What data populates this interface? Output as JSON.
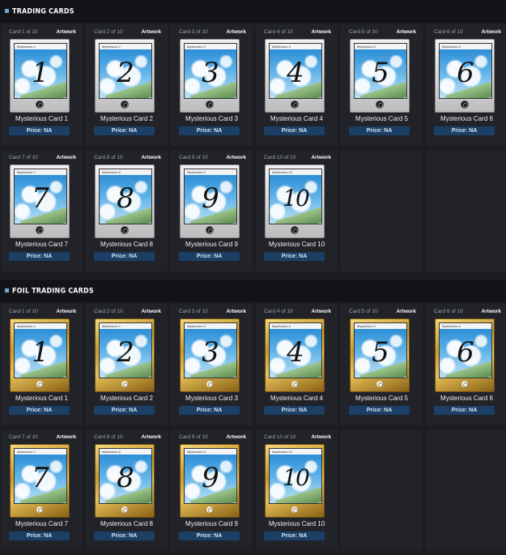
{
  "sections": [
    {
      "title": "TRADING CARDS",
      "variant": "normal",
      "cards": [
        {
          "counter": "Card 1 of 10",
          "artwork": "Artwork",
          "label": "Mysterious 1",
          "number": "1",
          "name": "Mysterious Card 1",
          "price": "Price: NA"
        },
        {
          "counter": "Card 2 of 10",
          "artwork": "Artwork",
          "label": "Mysterious 2",
          "number": "2",
          "name": "Mysterious Card 2",
          "price": "Price: NA"
        },
        {
          "counter": "Card 3 of 10",
          "artwork": "Artwork",
          "label": "Mysterious 3",
          "number": "3",
          "name": "Mysterious Card 3",
          "price": "Price: NA"
        },
        {
          "counter": "Card 4 of 10",
          "artwork": "Artwork",
          "label": "Mysterious 4",
          "number": "4",
          "name": "Mysterious Card 4",
          "price": "Price: NA"
        },
        {
          "counter": "Card 5 of 10",
          "artwork": "Artwork",
          "label": "Mysterious 5",
          "number": "5",
          "name": "Mysterious Card 5",
          "price": "Price: NA"
        },
        {
          "counter": "Card 6 of 10",
          "artwork": "Artwork",
          "label": "Mysterious 6",
          "number": "6",
          "name": "Mysterious Card 6",
          "price": "Price: NA"
        },
        {
          "counter": "Card 7 of 10",
          "artwork": "Artwork",
          "label": "Mysterious 7",
          "number": "7",
          "name": "Mysterious Card 7",
          "price": "Price: NA"
        },
        {
          "counter": "Card 8 of 10",
          "artwork": "Artwork",
          "label": "Mysterious 8",
          "number": "8",
          "name": "Mysterious Card 8",
          "price": "Price: NA"
        },
        {
          "counter": "Card 9 of 10",
          "artwork": "Artwork",
          "label": "Mysterious 9",
          "number": "9",
          "name": "Mysterious Card 9",
          "price": "Price: NA"
        },
        {
          "counter": "Card 10 of 10",
          "artwork": "Artwork",
          "label": "Mysterious 10",
          "number": "10",
          "name": "Mysterious Card 10",
          "price": "Price: NA"
        }
      ]
    },
    {
      "title": "FOIL TRADING CARDS",
      "variant": "foil",
      "cards": [
        {
          "counter": "Card 1 of 10",
          "artwork": "Artwork",
          "label": "Mysterious 1",
          "number": "1",
          "name": "Mysterious Card 1",
          "price": "Price: NA"
        },
        {
          "counter": "Card 2 of 10",
          "artwork": "Artwork",
          "label": "Mysterious 2",
          "number": "2",
          "name": "Mysterious Card 2",
          "price": "Price: NA"
        },
        {
          "counter": "Card 3 of 10",
          "artwork": "Artwork",
          "label": "Mysterious 3",
          "number": "3",
          "name": "Mysterious Card 3",
          "price": "Price: NA"
        },
        {
          "counter": "Card 4 of 10",
          "artwork": "Artwork",
          "label": "Mysterious 4",
          "number": "4",
          "name": "Mysterious Card 4",
          "price": "Price: NA"
        },
        {
          "counter": "Card 5 of 10",
          "artwork": "Artwork",
          "label": "Mysterious 5",
          "number": "5",
          "name": "Mysterious Card 5",
          "price": "Price: NA"
        },
        {
          "counter": "Card 6 of 10",
          "artwork": "Artwork",
          "label": "Mysterious 6",
          "number": "6",
          "name": "Mysterious Card 6",
          "price": "Price: NA"
        },
        {
          "counter": "Card 7 of 10",
          "artwork": "Artwork",
          "label": "Mysterious 7",
          "number": "7",
          "name": "Mysterious Card 7",
          "price": "Price: NA"
        },
        {
          "counter": "Card 8 of 10",
          "artwork": "Artwork",
          "label": "Mysterious 8",
          "number": "8",
          "name": "Mysterious Card 8",
          "price": "Price: NA"
        },
        {
          "counter": "Card 9 of 10",
          "artwork": "Artwork",
          "label": "Mysterious 9",
          "number": "9",
          "name": "Mysterious Card 9",
          "price": "Price: NA"
        },
        {
          "counter": "Card 10 of 10",
          "artwork": "Artwork",
          "label": "Mysterious 10",
          "number": "10",
          "name": "Mysterious Card 10",
          "price": "Price: NA"
        }
      ]
    }
  ],
  "colors": {
    "page_bg": "#1b1d22",
    "cell_bg": "#212329",
    "header_bg": "#121418",
    "price_button_bg": "#1c3f66",
    "accent_bullet": "#67a8d8"
  },
  "icons": {
    "section_bullet": "square-bullet-icon",
    "card_badge": "steam-logo-icon"
  }
}
